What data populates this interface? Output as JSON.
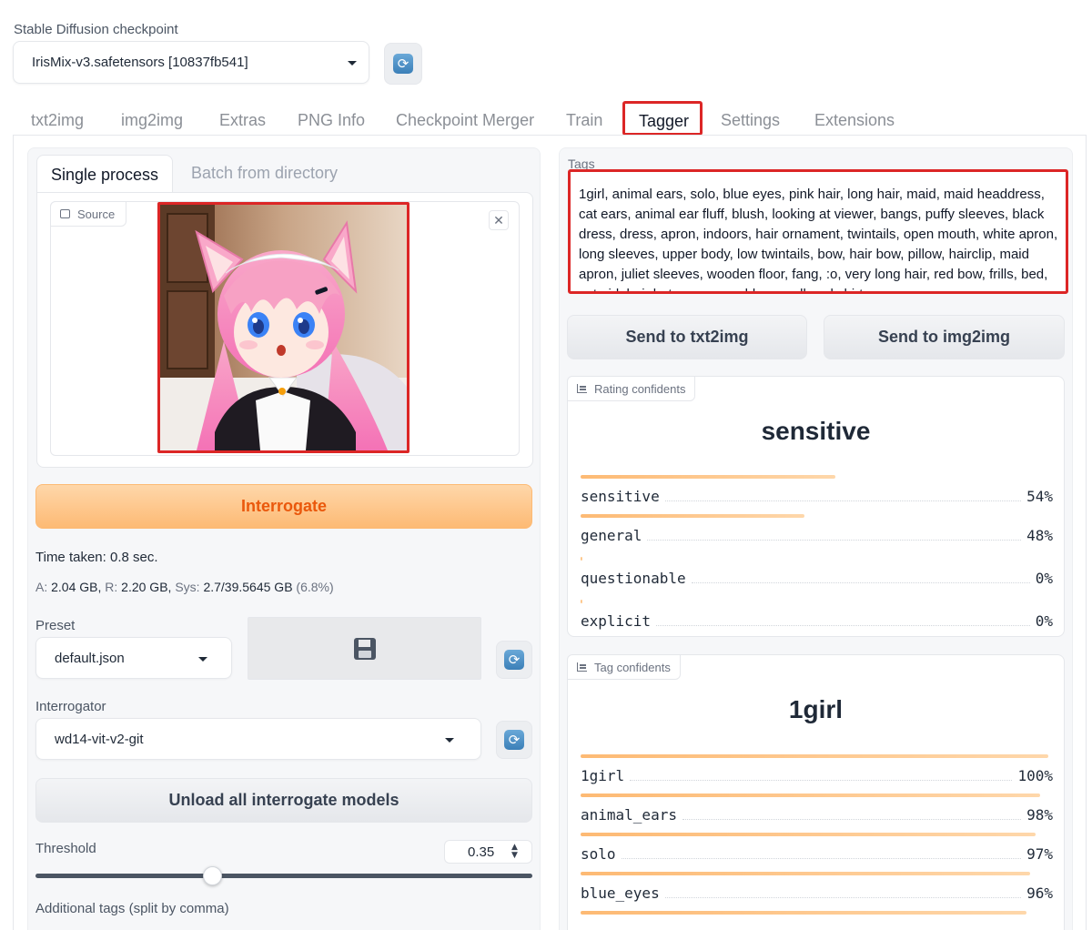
{
  "checkpoint": {
    "label": "Stable Diffusion checkpoint",
    "value": "IrisMix-v3.safetensors [10837fb541]",
    "refresh_icon": "refresh-icon"
  },
  "tabs": [
    {
      "label": "txt2img"
    },
    {
      "label": "img2img"
    },
    {
      "label": "Extras"
    },
    {
      "label": "PNG Info"
    },
    {
      "label": "Checkpoint Merger"
    },
    {
      "label": "Train"
    },
    {
      "label": "Tagger",
      "active": true
    },
    {
      "label": "Settings"
    },
    {
      "label": "Extensions"
    }
  ],
  "left": {
    "subtabs": {
      "single": "Single process",
      "batch": "Batch from directory"
    },
    "source": {
      "label": "Source",
      "close": "✕"
    },
    "interrogate_label": "Interrogate",
    "time_taken": "Time taken: 0.8 sec.",
    "memory": {
      "a_label": "A:",
      "a_val": "2.04 GB,",
      "r_label": "R:",
      "r_val": "2.20 GB,",
      "sys_label": "Sys:",
      "sys_val": "2.7/39.5645 GB",
      "pct": "(6.8%)"
    },
    "preset": {
      "label": "Preset",
      "value": "default.json"
    },
    "interrogator": {
      "label": "Interrogator",
      "value": "wd14-vit-v2-git"
    },
    "unload_label": "Unload all interrogate models",
    "threshold": {
      "label": "Threshold",
      "value": "0.35",
      "fraction": 0.35
    },
    "additional_tags_label": "Additional tags (split by comma)"
  },
  "right": {
    "tags_label": "Tags",
    "tags_text": "1girl, animal ears, solo, blue eyes, pink hair, long hair, maid, maid headdress, cat ears, animal ear fluff, blush, looking at viewer, bangs, puffy sleeves, black dress, dress, apron, indoors, hair ornament, twintails, open mouth, white apron, long sleeves, upper body, low twintails, bow, hair bow, pillow, hairclip, maid apron, juliet sleeves, wooden floor, fang, :o, very long hair, red bow, frills, bed, cat girl, hair between eyes, blurry, collared shirt",
    "send_txt2img": "Send to txt2img",
    "send_img2img": "Send to img2img",
    "rating": {
      "chip_label": "Rating confidents",
      "top": "sensitive",
      "rows": [
        {
          "name": "sensitive",
          "pct": "54%",
          "value": 0.54
        },
        {
          "name": "general",
          "pct": "48%",
          "value": 0.48
        },
        {
          "name": "questionable",
          "pct": "0%",
          "value": 0.0
        },
        {
          "name": "explicit",
          "pct": "0%",
          "value": 0.0
        }
      ]
    },
    "tag_conf": {
      "chip_label": "Tag confidents",
      "top": "1girl",
      "rows": [
        {
          "name": "1girl",
          "pct": "100%",
          "value": 1.0
        },
        {
          "name": "animal_ears",
          "pct": "98%",
          "value": 0.98
        },
        {
          "name": "solo",
          "pct": "97%",
          "value": 0.97
        },
        {
          "name": "blue_eyes",
          "pct": "96%",
          "value": 0.96
        }
      ]
    }
  },
  "colors": {
    "accent": "#ea580c",
    "highlight": "#dc2626",
    "bar_start": "#fdba74",
    "bar_end": "#fed7aa"
  }
}
